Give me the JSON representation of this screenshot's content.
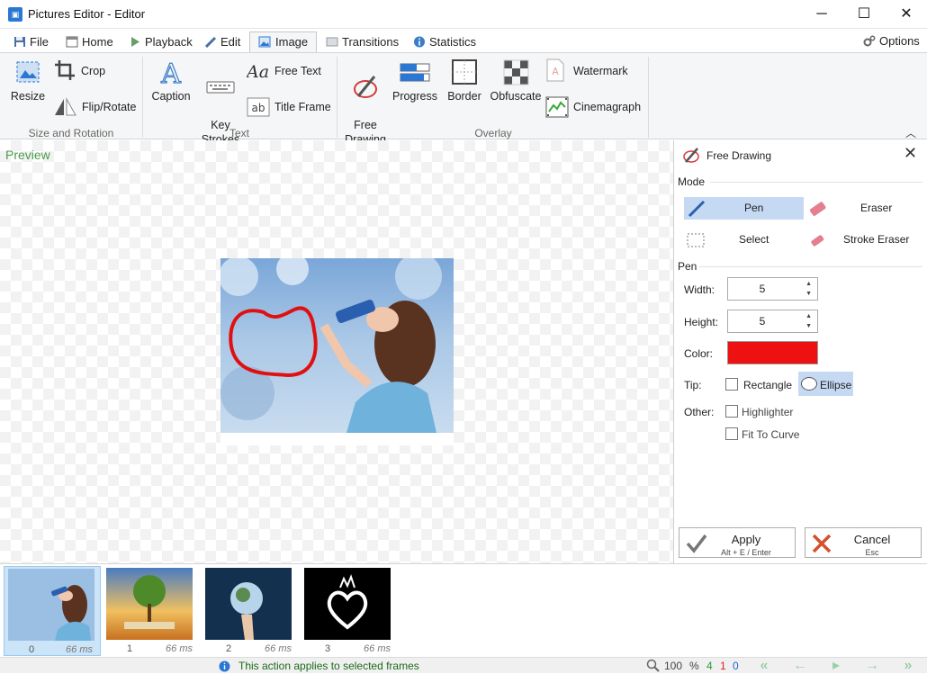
{
  "window": {
    "title": "Pictures Editor - Editor",
    "minimize": "─",
    "maximize": "☐",
    "close": "✕"
  },
  "tabs": [
    {
      "label": "File"
    },
    {
      "label": "Home"
    },
    {
      "label": "Playback"
    },
    {
      "label": "Edit"
    },
    {
      "label": "Image"
    },
    {
      "label": "Transitions"
    },
    {
      "label": "Statistics"
    }
  ],
  "options_label": "Options",
  "ribbon": {
    "resize": "Resize",
    "crop": "Crop",
    "flip_rotate": "Flip/Rotate",
    "group_size": "Size and Rotation",
    "caption": "Caption",
    "key_strokes": "Key\nStrokes",
    "free_text": "Free Text",
    "title_frame": "Title Frame",
    "group_text": "Text",
    "free_drawing": "Free\nDrawing",
    "progress": "Progress",
    "border": "Border",
    "obfuscate": "Obfuscate",
    "watermark": "Watermark",
    "cinemagraph": "Cinemagraph",
    "group_overlay": "Overlay"
  },
  "preview": {
    "label": "Preview"
  },
  "panel": {
    "title": "Free Drawing",
    "mode_label": "Mode",
    "pen": "Pen",
    "eraser": "Eraser",
    "select": "Select",
    "stroke_eraser": "Stroke Eraser",
    "pen_label": "Pen",
    "width_label": "Width:",
    "width_value": "5",
    "height_label": "Height:",
    "height_value": "5",
    "color_label": "Color:",
    "color_value": "#ee1111",
    "tip_label": "Tip:",
    "tip_rect": "Rectangle",
    "tip_ellipse": "Ellipse",
    "other_label": "Other:",
    "highlighter": "Highlighter",
    "fit_to_curve": "Fit To Curve",
    "apply": "Apply",
    "apply_shortcut": "Alt + E / Enter",
    "cancel": "Cancel",
    "cancel_shortcut": "Esc"
  },
  "frames": [
    {
      "index": "0",
      "delay": "66 ms"
    },
    {
      "index": "1",
      "delay": "66 ms"
    },
    {
      "index": "2",
      "delay": "66 ms"
    },
    {
      "index": "3",
      "delay": "66 ms"
    }
  ],
  "status": {
    "message": "This action applies to selected frames",
    "zoom": "100",
    "zoom_unit": "%",
    "count_total": "4",
    "count_selected": "1",
    "count_current": "0"
  },
  "colors": {
    "accent": "#2b78d4",
    "selection": "#c5d9f3",
    "status_green": "#2e9a2e",
    "status_red": "#d22",
    "status_blue": "#2266cc"
  }
}
